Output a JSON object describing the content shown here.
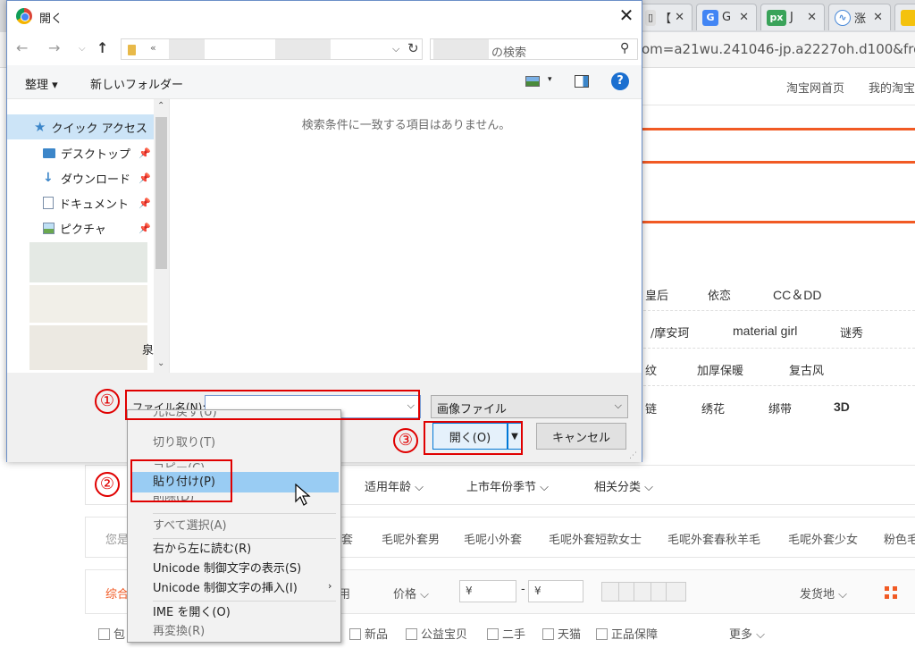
{
  "browser": {
    "tabs": [
      {
        "label": "【",
        "icon": "doc-icon",
        "color": "#e8e8e8"
      },
      {
        "label": "G",
        "icon": "translate-icon",
        "color": "#4285f4"
      },
      {
        "label": "J",
        "icon": "px-icon",
        "color": "#3aa35a"
      },
      {
        "label": "涨",
        "icon": "wave-icon",
        "color": "#4a8ad9"
      }
    ],
    "url_visible": "om=a21wu.241046-jp.a2227oh.d100&fron",
    "nav_links": [
      "淘宝网首页",
      "我的淘宝"
    ]
  },
  "page": {
    "categories_row1": [
      "皇后",
      "依恋",
      "CC＆DD"
    ],
    "categories_row2": [
      "/摩安珂",
      "material girl",
      "谜秀"
    ],
    "categories_row3": [
      "纹",
      "加厚保暖",
      "复古风"
    ],
    "categories_row4": [
      "链",
      "绣花",
      "绑带",
      "3D"
    ],
    "filters": [
      "适用年龄",
      "上市年份季节",
      "相关分类"
    ],
    "suggest_prefix": "您是",
    "suggestions": [
      "套",
      "毛呢外套男",
      "毛呢小外套",
      "毛呢外套短款女士",
      "毛呢外套春秋羊毛",
      "毛呢外套少女",
      "粉色毛"
    ],
    "sort_left": "综合",
    "sort_items": [
      "用",
      "价格"
    ],
    "price_from": "¥",
    "price_to": "¥",
    "price_sep": "-",
    "ship_from": "发货地",
    "checks": [
      "包",
      "新品",
      "公益宝贝",
      "二手",
      "天猫",
      "正品保障"
    ],
    "more": "更多"
  },
  "dialog": {
    "title": "開く",
    "search_placeholder": "の検索",
    "breadcrumb_sep": "«",
    "toolbar": {
      "organize": "整理",
      "new_folder": "新しいフォルダー"
    },
    "nav": [
      {
        "label": "クイック アクセス"
      },
      {
        "label": "デスクトップ"
      },
      {
        "label": "ダウンロード"
      },
      {
        "label": "ドキュメント"
      },
      {
        "label": "ピクチャ"
      }
    ],
    "empty_message": "検索条件に一致する項目はありません。",
    "filename_label": "ファイル名(N):",
    "filetype": "画像ファイル",
    "open_button": "開く(O)",
    "cancel_button": "キャンセル"
  },
  "context_menu": {
    "items": [
      {
        "label": "元に戻す(U)",
        "enabled": false
      },
      {
        "label": "切り取り(T)",
        "enabled": false
      },
      {
        "label": "コピー(C)",
        "enabled": false
      },
      {
        "label": "貼り付け(P)",
        "enabled": true
      },
      {
        "label": "削除(D)",
        "enabled": false
      },
      {
        "label": "すべて選択(A)",
        "enabled": false
      },
      {
        "label": "右から左に読む(R)",
        "enabled": true
      },
      {
        "label": "Unicode 制御文字の表示(S)",
        "enabled": true
      },
      {
        "label": "Unicode 制御文字の挿入(I)",
        "enabled": true
      },
      {
        "label": "IME を開く(O)",
        "enabled": true
      },
      {
        "label": "再変換(R)",
        "enabled": false
      }
    ]
  },
  "annotations": {
    "step1": "①",
    "step2": "②",
    "step3": "③"
  },
  "colors": {
    "annotation_red": "#e00000",
    "taobao_orange": "#f15a24",
    "menu_highlight": "#99ccf3"
  }
}
